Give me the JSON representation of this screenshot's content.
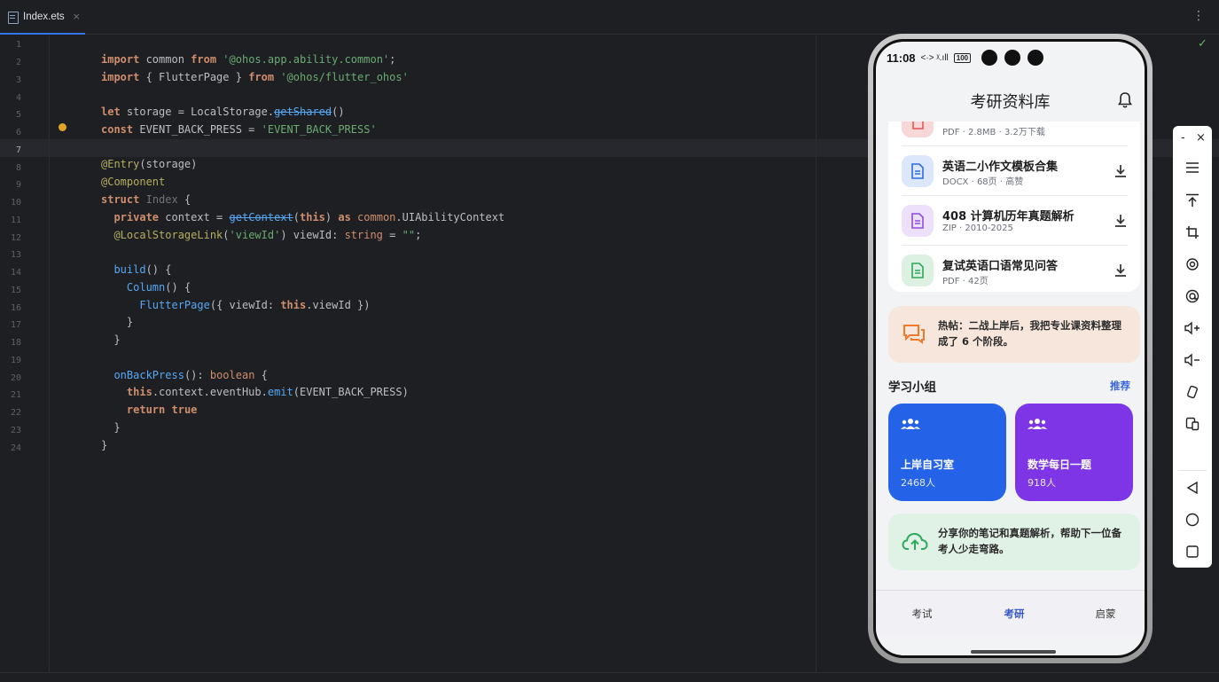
{
  "ide": {
    "tab_label": "Index.ets",
    "tab_close": "×",
    "menu_glyph": "⋮",
    "status_glyph": "✓",
    "line_numbers": [
      "1",
      "2",
      "3",
      "4",
      "5",
      "6",
      "7",
      "8",
      "9",
      "10",
      "11",
      "12",
      "13",
      "14",
      "15",
      "16",
      "17",
      "18",
      "19",
      "20",
      "21",
      "22",
      "23",
      "24"
    ],
    "code": {
      "l2": [
        "import",
        " common ",
        "from",
        " ",
        "'@ohos.app.ability.common'",
        ";"
      ],
      "l3": [
        "import",
        " { FlutterPage } ",
        "from",
        " ",
        "'@ohos/flutter_ohos'"
      ],
      "l5": [
        "let",
        " storage = LocalStorage.",
        "getShared",
        "()"
      ],
      "l6": [
        "const",
        " EVENT_BACK_PRESS = ",
        "'EVENT_BACK_PRESS'"
      ],
      "l8": [
        "@Entry",
        "(storage)"
      ],
      "l9": [
        "@Component"
      ],
      "l10": [
        "struct",
        " ",
        "Index",
        " {"
      ],
      "l11": [
        "  ",
        "private",
        " context = ",
        "getContext",
        "(",
        "this",
        ") ",
        "as",
        " ",
        "common",
        ".UIAbilityContext"
      ],
      "l12": [
        "  ",
        "@LocalStorageLink",
        "(",
        "'viewId'",
        ") viewId: ",
        "string",
        " = ",
        "\"\"",
        ";"
      ],
      "l14": [
        "  ",
        "build",
        "() {"
      ],
      "l15": [
        "    ",
        "Column",
        "() {"
      ],
      "l16": [
        "      ",
        "FlutterPage",
        "({ viewId: ",
        "this",
        ".viewId })"
      ],
      "l17": [
        "    }"
      ],
      "l18": [
        "  }"
      ],
      "l20": [
        "  ",
        "onBackPress",
        "(): ",
        "boolean",
        " {"
      ],
      "l21": [
        "    ",
        "this",
        ".context.eventHub.",
        "emit",
        "(EVENT_BACK_PRESS)"
      ],
      "l22": [
        "    ",
        "return",
        " ",
        "true"
      ],
      "l23": [
        "  }"
      ],
      "l24": [
        "}"
      ]
    }
  },
  "phone": {
    "status": {
      "time": "11:08",
      "icons": "<·> ᵡ.ıll",
      "battery": "100"
    },
    "header": {
      "title": "考研资料库"
    },
    "files": [
      {
        "title": "",
        "meta": "PDF · 2.8MB · 3.2万下载",
        "color": "#f8d7d7"
      },
      {
        "title": "英语二小作文模板合集",
        "meta": "DOCX · 68页 · 高赞",
        "color": "#dde7fb"
      },
      {
        "title": "408 计算机历年真题解析",
        "meta": "ZIP · 2010-2025",
        "color": "#ece0fa"
      },
      {
        "title": "复试英语口语常见问答",
        "meta": "PDF · 42页",
        "color": "#dcf1e2"
      }
    ],
    "hot_post": "热帖：二战上岸后，我把专业课资料整理成了 6 个阶段。",
    "groups_section": {
      "title": "学习小组",
      "link": "推荐"
    },
    "groups": [
      {
        "name": "上岸自习室",
        "count": "2468人"
      },
      {
        "name": "数学每日一题",
        "count": "918人"
      }
    ],
    "share": "分享你的笔记和真题解析，帮助下一位备考人少走弯路。",
    "tabs": [
      {
        "label": "考试"
      },
      {
        "label": "考研"
      },
      {
        "label": "启蒙"
      }
    ],
    "colors": {
      "accent": "#3557c8",
      "group_blue": "#2463e8",
      "group_purple": "#7d35e6"
    }
  },
  "emulator_toolbar": {
    "minimize": "-",
    "close": "×",
    "buttons": [
      "menu-icon",
      "pin-top-icon",
      "crop-icon",
      "screenshot-icon",
      "record-icon",
      "volume-up-icon",
      "volume-down-icon",
      "rotate-icon",
      "multi-device-icon",
      "back-icon",
      "home-icon",
      "recents-icon"
    ]
  }
}
